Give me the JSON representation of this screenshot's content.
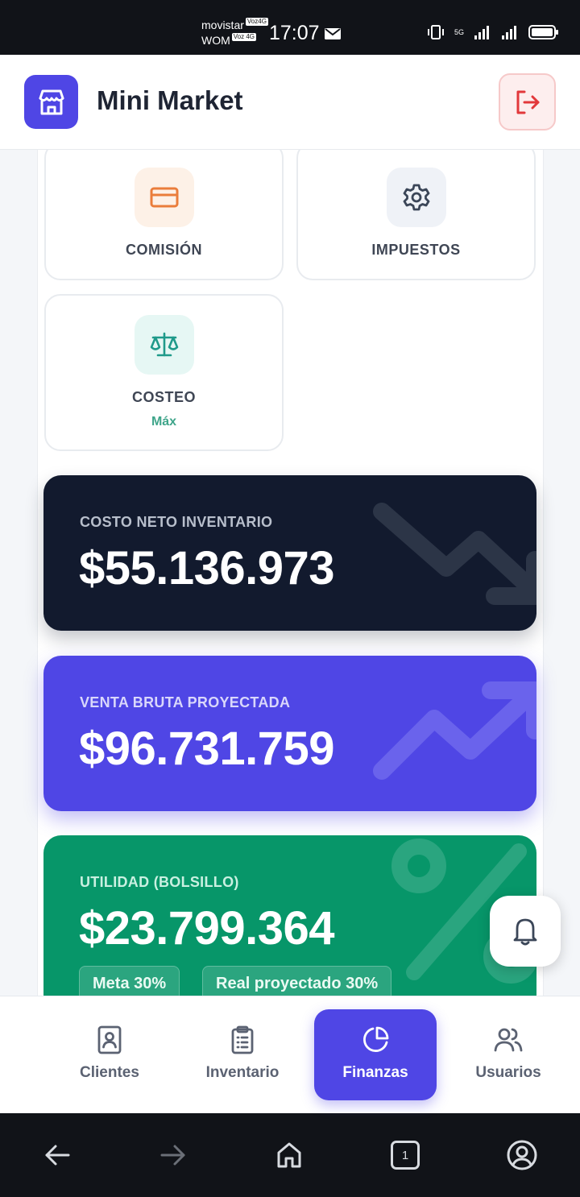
{
  "status_bar": {
    "carrier_1": "movistar",
    "carrier_1_tag": "Voz4G",
    "carrier_2": "WOM",
    "carrier_2_tag": "Voz 4G",
    "time": "17:07",
    "network_label": "5G"
  },
  "header": {
    "title": "Mini Market",
    "logo_icon": "store-icon",
    "logout_icon": "logout-icon"
  },
  "tiles": [
    {
      "label": "COMISIÓN",
      "sub": "",
      "icon": "credit-card-icon",
      "accent": "#ea7d3b"
    },
    {
      "label": "IMPUESTOS",
      "sub": "",
      "icon": "gear-icon",
      "accent": "#3b4658"
    },
    {
      "label": "COSTEO",
      "sub": "Máx",
      "icon": "scale-icon",
      "accent": "#1f9a8a"
    }
  ],
  "cards": {
    "inventory": {
      "label": "COSTO NETO INVENTARIO",
      "value": "$55.136.973",
      "color": "#121a2e"
    },
    "sales": {
      "label": "VENTA BRUTA PROYECTADA",
      "value": "$96.731.759",
      "color": "#4f46e5"
    },
    "profit": {
      "label": "UTILIDAD (BOLSILLO)",
      "value": "$23.799.364",
      "color": "#079669",
      "chips": [
        "Meta 30%",
        "Real proyectado 30%"
      ]
    }
  },
  "bottom_nav": {
    "items": [
      {
        "label": "Clientes",
        "icon": "contact-book-icon",
        "active": false
      },
      {
        "label": "Inventario",
        "icon": "clipboard-icon",
        "active": false
      },
      {
        "label": "Finanzas",
        "icon": "pie-chart-icon",
        "active": true
      },
      {
        "label": "Usuarios",
        "icon": "users-icon",
        "active": false
      }
    ]
  },
  "system_nav": {
    "tab_count": "1"
  }
}
